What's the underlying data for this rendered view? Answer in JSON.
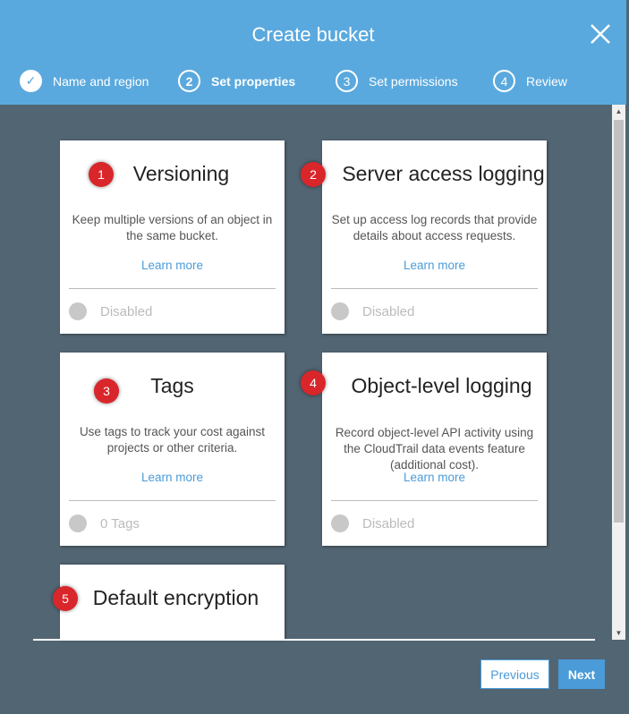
{
  "header": {
    "title": "Create bucket",
    "steps": [
      {
        "num": "✓",
        "label": "Name and region",
        "state": "done"
      },
      {
        "num": "2",
        "label": "Set properties",
        "state": "active"
      },
      {
        "num": "3",
        "label": "Set permissions",
        "state": "pending"
      },
      {
        "num": "4",
        "label": "Review",
        "state": "pending"
      }
    ]
  },
  "cards": [
    {
      "badge": "1",
      "title": "Versioning",
      "desc": "Keep multiple versions of an object in the same bucket.",
      "link": "Learn more",
      "status": "Disabled"
    },
    {
      "badge": "2",
      "title": "Server access logging",
      "desc": "Set up access log records that provide details about access requests.",
      "link": "Learn more",
      "status": "Disabled"
    },
    {
      "badge": "3",
      "title": "Tags",
      "desc": "Use tags to track your cost against projects or other criteria.",
      "link": "Learn more",
      "status": "0 Tags"
    },
    {
      "badge": "4",
      "title": "Object-level logging",
      "desc": "Record object-level API activity using the CloudTrail data events feature (additional cost).",
      "link": "Learn more",
      "status": "Disabled"
    },
    {
      "badge": "5",
      "title": "Default encryption"
    }
  ],
  "footer": {
    "previous": "Previous",
    "next": "Next"
  },
  "colors": {
    "header": "#5aa9de",
    "body": "#526573",
    "accent": "#4a9bd8",
    "badge": "#d9262b"
  }
}
